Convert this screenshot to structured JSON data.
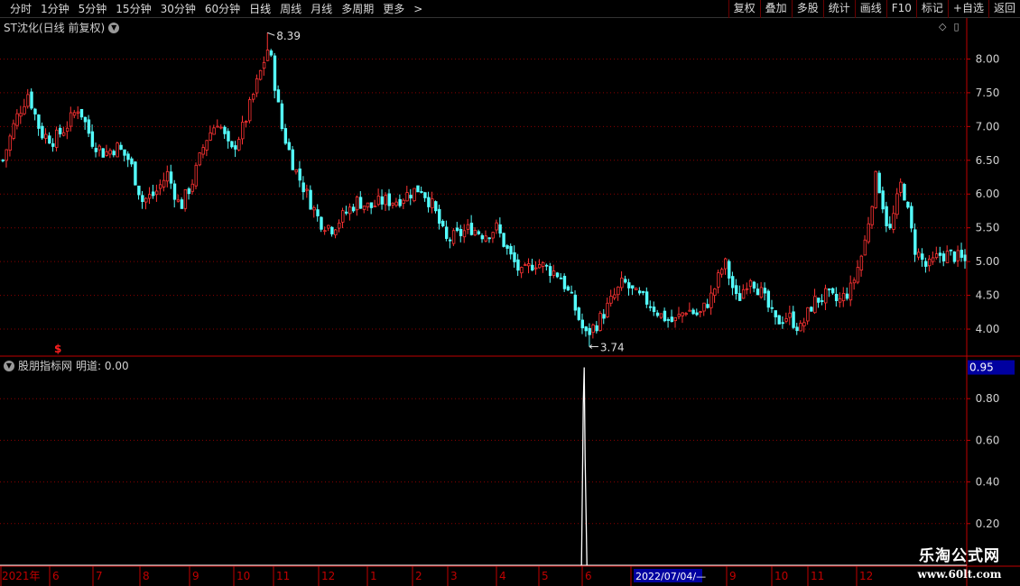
{
  "toolbar": {
    "periods": [
      "分时",
      "1分钟",
      "5分钟",
      "15分钟",
      "30分钟",
      "60分钟",
      "日线",
      "周线",
      "月线",
      "多周期",
      "更多"
    ],
    "active_period": "日线",
    "more_arrow": ">",
    "right_buttons": [
      "复权",
      "叠加",
      "多股",
      "统计",
      "画线",
      "F10",
      "标记",
      "+自选",
      "返回"
    ]
  },
  "price_panel": {
    "title": "ST沈化(日线 前复权)",
    "high_label": "8.39",
    "low_label": "3.74",
    "y_ticks": [
      "8.00",
      "7.50",
      "7.00",
      "6.50",
      "6.00",
      "5.50",
      "5.00",
      "4.50",
      "4.00"
    ],
    "marker_glyph": "$",
    "tool_icons": [
      "◇",
      "▯"
    ]
  },
  "indicator_panel": {
    "title": "股朋指标网",
    "value_label": "明道: 0.00",
    "current_value": "0.95",
    "y_ticks": [
      "0.80",
      "0.60",
      "0.40",
      "0.20"
    ]
  },
  "date_axis": {
    "year_label": "2021年",
    "month_labels": [
      "6",
      "7",
      "8",
      "9",
      "10",
      "11",
      "12",
      "1",
      "2",
      "3",
      "4",
      "5",
      "6",
      "2022/07/04/—",
      "9",
      "10",
      "11",
      "12"
    ]
  },
  "watermark": {
    "line1": "乐淘公式网",
    "line2": "www.60lt.com"
  },
  "colors": {
    "up": "#ff3333",
    "down": "#54ffff",
    "grid": "#8a0000",
    "axis": "#c00000",
    "highlight_bg": "#0000a0"
  },
  "chart_data": {
    "type": "candlestick",
    "price_range": [
      3.6,
      8.5
    ],
    "indicator_range": [
      0,
      1
    ],
    "closes": [
      6.5,
      7.1,
      7.5,
      6.9,
      6.8,
      7.0,
      7.3,
      6.8,
      6.6,
      6.7,
      6.5,
      5.9,
      6.0,
      6.3,
      5.8,
      6.2,
      6.8,
      7.1,
      6.6,
      7.0,
      7.6,
      8.2,
      7.0,
      6.4,
      6.0,
      5.6,
      5.5,
      5.7,
      5.9,
      5.8,
      5.9,
      5.9,
      6.0,
      6.1,
      5.8,
      5.3,
      5.4,
      5.5,
      5.4,
      5.5,
      5.1,
      4.8,
      5.0,
      4.9,
      4.8,
      4.4,
      3.9,
      4.1,
      4.4,
      4.7,
      4.5,
      4.4,
      4.2,
      4.1,
      4.3,
      4.2,
      4.5,
      5.0,
      4.4,
      4.8,
      4.5,
      4.1,
      4.2,
      4.0,
      4.4,
      4.5,
      4.4,
      4.6,
      5.2,
      6.3,
      5.4,
      6.2,
      5.2,
      4.9,
      5.1,
      5.1,
      5.0
    ],
    "indicator_spike": {
      "date_index": 46,
      "value": 0.95
    }
  }
}
